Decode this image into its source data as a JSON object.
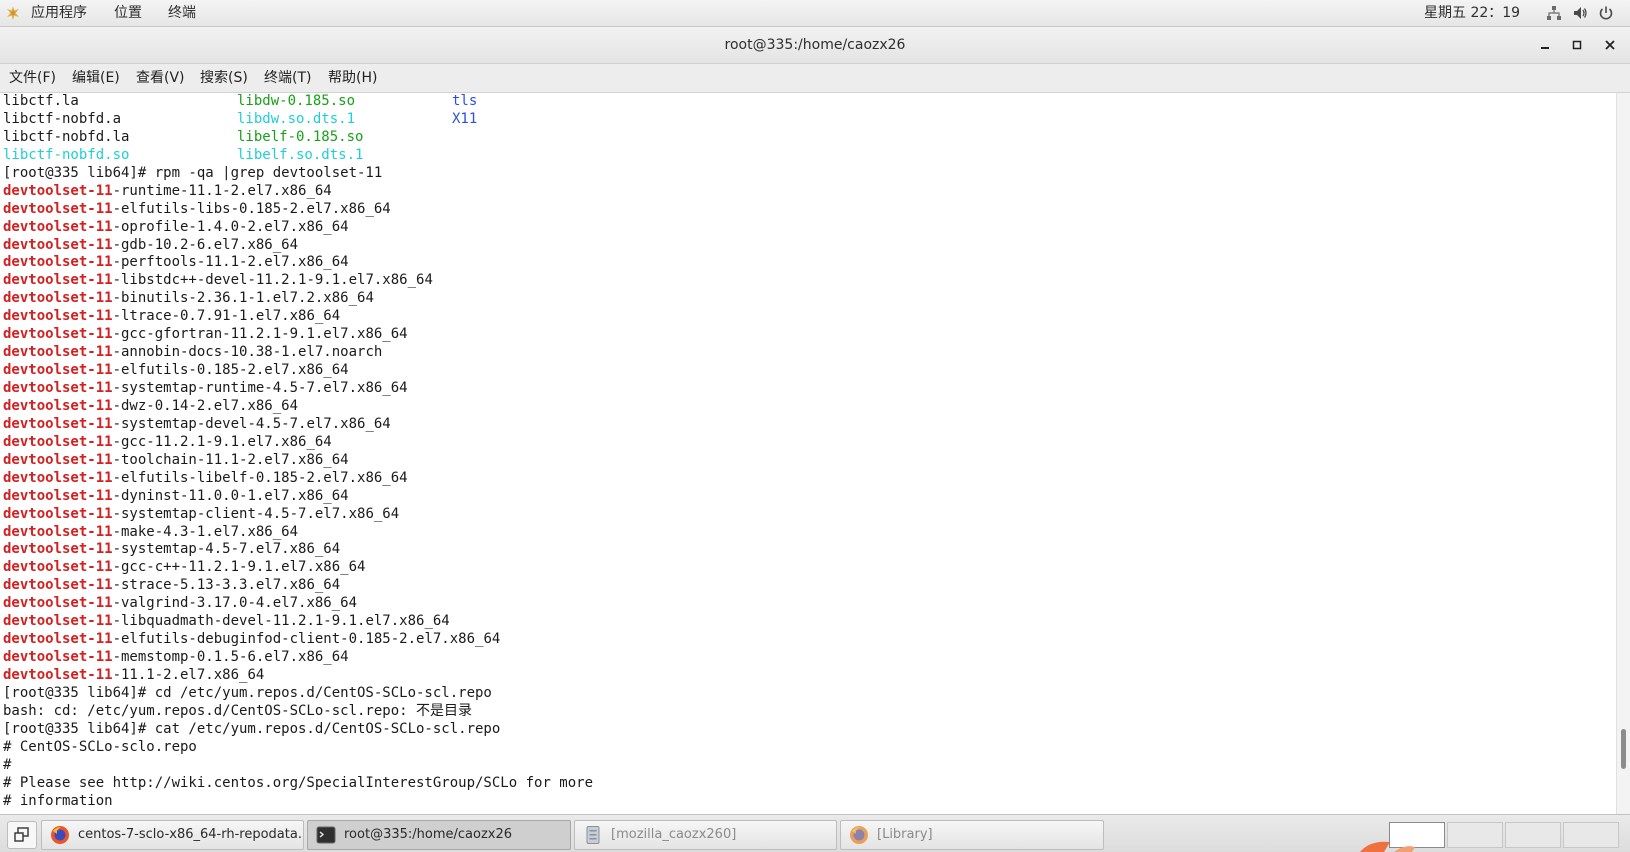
{
  "top_panel": {
    "applications": "应用程序",
    "places": "位置",
    "terminal_menu": "终端",
    "clock": "星期五 22：19",
    "icons": [
      "applications-icon",
      "network-icon",
      "volume-icon",
      "power-icon"
    ]
  },
  "window": {
    "title": "root@335:/home/caozx26",
    "controls": [
      "minimize",
      "maximize",
      "close"
    ]
  },
  "menubar": [
    "文件(F)",
    "编辑(E)",
    "查看(V)",
    "搜索(S)",
    "终端(T)",
    "帮助(H)"
  ],
  "terminal": {
    "ls_rows": [
      [
        "libctf.la",
        "libdw-0.185.so",
        "tls"
      ],
      [
        "libctf-nobfd.a",
        "libdw.so.dts.1",
        "X11"
      ],
      [
        "libctf-nobfd.la",
        "libelf-0.185.so",
        ""
      ],
      [
        "libctf-nobfd.so",
        "libelf.so.dts.1",
        ""
      ]
    ],
    "prompt1": "[root@335 lib64]# rpm -qa |grep devtoolset-11",
    "pkg_prefix": "devtoolset-11",
    "packages": [
      "-runtime-11.1-2.el7.x86_64",
      "-elfutils-libs-0.185-2.el7.x86_64",
      "-oprofile-1.4.0-2.el7.x86_64",
      "-gdb-10.2-6.el7.x86_64",
      "-perftools-11.1-2.el7.x86_64",
      "-libstdc++-devel-11.2.1-9.1.el7.x86_64",
      "-binutils-2.36.1-1.el7.2.x86_64",
      "-ltrace-0.7.91-1.el7.x86_64",
      "-gcc-gfortran-11.2.1-9.1.el7.x86_64",
      "-annobin-docs-10.38-1.el7.noarch",
      "-elfutils-0.185-2.el7.x86_64",
      "-systemtap-runtime-4.5-7.el7.x86_64",
      "-dwz-0.14-2.el7.x86_64",
      "-systemtap-devel-4.5-7.el7.x86_64",
      "-gcc-11.2.1-9.1.el7.x86_64",
      "-toolchain-11.1-2.el7.x86_64",
      "-elfutils-libelf-0.185-2.el7.x86_64",
      "-dyninst-11.0.0-1.el7.x86_64",
      "-systemtap-client-4.5-7.el7.x86_64",
      "-make-4.3-1.el7.x86_64",
      "-systemtap-4.5-7.el7.x86_64",
      "-gcc-c++-11.2.1-9.1.el7.x86_64",
      "-strace-5.13-3.3.el7.x86_64",
      "-valgrind-3.17.0-4.el7.x86_64",
      "-libquadmath-devel-11.2.1-9.1.el7.x86_64",
      "-elfutils-debuginfod-client-0.185-2.el7.x86_64",
      "-memstomp-0.1.5-6.el7.x86_64",
      "-11.1-2.el7.x86_64"
    ],
    "tail_lines": [
      "[root@335 lib64]# cd /etc/yum.repos.d/CentOS-SCLo-scl.repo",
      "bash: cd: /etc/yum.repos.d/CentOS-SCLo-scl.repo: 不是目录",
      "[root@335 lib64]# cat /etc/yum.repos.d/CentOS-SCLo-scl.repo",
      "# CentOS-SCLo-sclo.repo",
      "#",
      "# Please see http://wiki.centos.org/SpecialInterestGroup/SCLo for more",
      "# information"
    ],
    "colors": {
      "pkg_prefix": "#d42020",
      "ls_green": "#16a116",
      "ls_cyan": "#1fcfd6",
      "ls_blue": "#2d4fe0",
      "text": "#1a1a1a"
    }
  },
  "taskbar": {
    "tasks": [
      {
        "label": "centos-7-sclo-x86_64-rh-repodata...",
        "icon": "firefox-icon",
        "state": "normal"
      },
      {
        "label": "root@335:/home/caozx26",
        "icon": "terminal-icon",
        "state": "active"
      },
      {
        "label": "[mozilla_caozx260]",
        "icon": "file-manager-icon",
        "state": "dim"
      },
      {
        "label": "[Library]",
        "icon": "firefox-icon",
        "state": "dim"
      }
    ],
    "workspaces": 4,
    "current_workspace": 1
  }
}
